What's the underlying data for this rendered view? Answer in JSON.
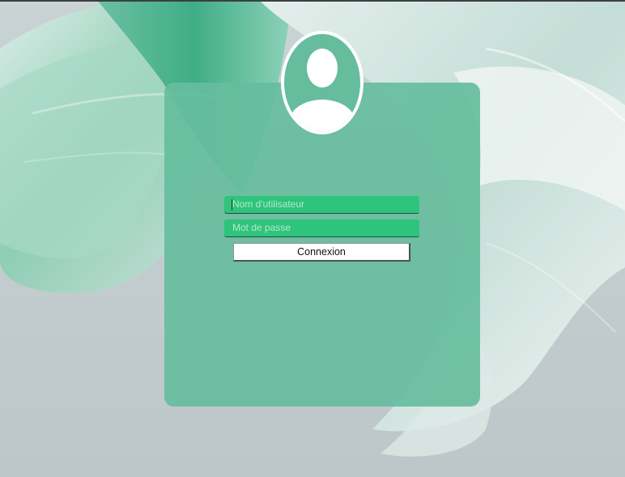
{
  "login": {
    "username_placeholder": "Nom d'utilisateur",
    "password_placeholder": "Mot de passe",
    "submit_label": "Connexion"
  },
  "icons": {
    "avatar": "user-avatar-icon"
  },
  "colors": {
    "card_bg": "#66bd9e",
    "field_bg": "#2fc47c",
    "field_placeholder": "#b7e6cd",
    "button_bg": "#ffffff",
    "wallpaper_primary": "#5fb394",
    "wallpaper_bg": "#bfc8cb"
  }
}
